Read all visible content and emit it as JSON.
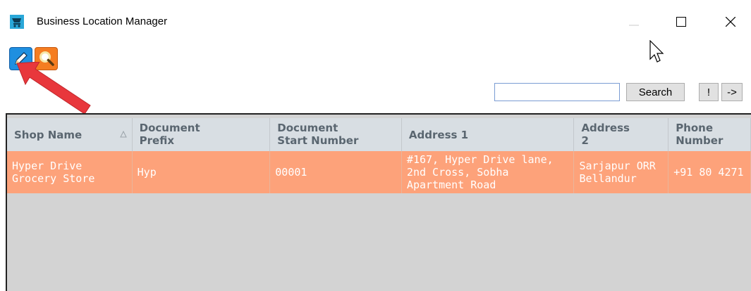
{
  "window": {
    "title": "Business Location Manager",
    "min_glyph": "—",
    "max_glyph": "☐",
    "close_glyph": "✕"
  },
  "search": {
    "value": "",
    "button": "Search",
    "bang": "!",
    "next": "->"
  },
  "columns": [
    "Shop Name",
    "Document\nPrefix",
    "Document\nStart Number",
    "Address 1",
    "Address\n2",
    "Phone\nNumber"
  ],
  "rows": [
    {
      "shop_name": "Hyper Drive\nGrocery Store",
      "prefix": "Hyp",
      "start_number": "00001",
      "address1": "#167, Hyper Drive lane,\n2nd Cross, Sobha\nApartment Road",
      "address2": "Sarjapur ORR\nBellandur",
      "phone": "+91 80 4271"
    }
  ],
  "colors": {
    "header_bg": "#d8dee3",
    "selected_row": "#fda27a",
    "edit_button": "#1f8fe0",
    "find_button": "#f57d21",
    "arrow": "#e8373c"
  },
  "icons": {
    "app": "shopping-cart-icon",
    "edit": "pencil-icon",
    "find": "magnifier-icon"
  }
}
